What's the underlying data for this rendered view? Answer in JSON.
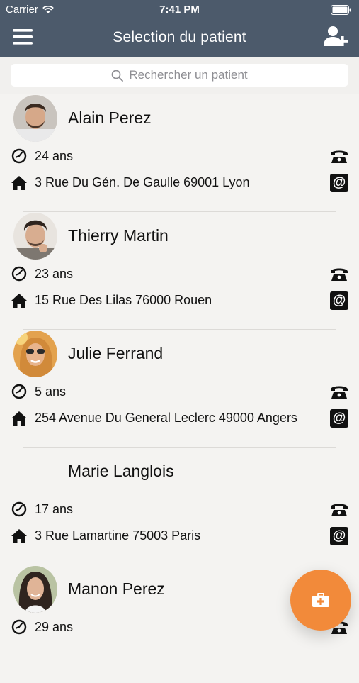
{
  "status_bar": {
    "carrier": "Carrier",
    "time": "7:41 PM"
  },
  "nav": {
    "title": "Selection du patient"
  },
  "search": {
    "placeholder": "Rechercher un patient"
  },
  "patients": [
    {
      "name": "Alain Perez",
      "age": "24 ans",
      "address": "3 Rue Du Gén. De Gaulle 69001 Lyon",
      "avatar": "man-beard-portrait"
    },
    {
      "name": "Thierry Martin",
      "age": "23 ans",
      "address": "15 Rue Des Lilas 76000 Rouen",
      "avatar": "man-hand-chin-portrait"
    },
    {
      "name": "Julie Ferrand",
      "age": "5 ans",
      "address": "254 Avenue Du General Leclerc 49000 Angers",
      "avatar": "woman-sunglasses-portrait"
    },
    {
      "name": "Marie Langlois",
      "age": "17 ans",
      "address": "3 Rue Lamartine 75003 Paris",
      "avatar": null
    },
    {
      "name": "Manon Perez",
      "age": "29 ans",
      "address": "",
      "avatar": "woman-dark-hair-portrait"
    }
  ],
  "icons": {
    "menu": "hamburger-icon",
    "add_patient": "add-user-icon",
    "search": "search-icon",
    "age": "clock-icon",
    "address": "house-icon",
    "phone": "phone-icon",
    "email": "at-email-icon",
    "fab": "medical-kit-icon"
  },
  "colors": {
    "navbar": "#4c5a6b",
    "fab": "#f28a3a",
    "background": "#f4f3f1"
  },
  "email_symbol": "@"
}
